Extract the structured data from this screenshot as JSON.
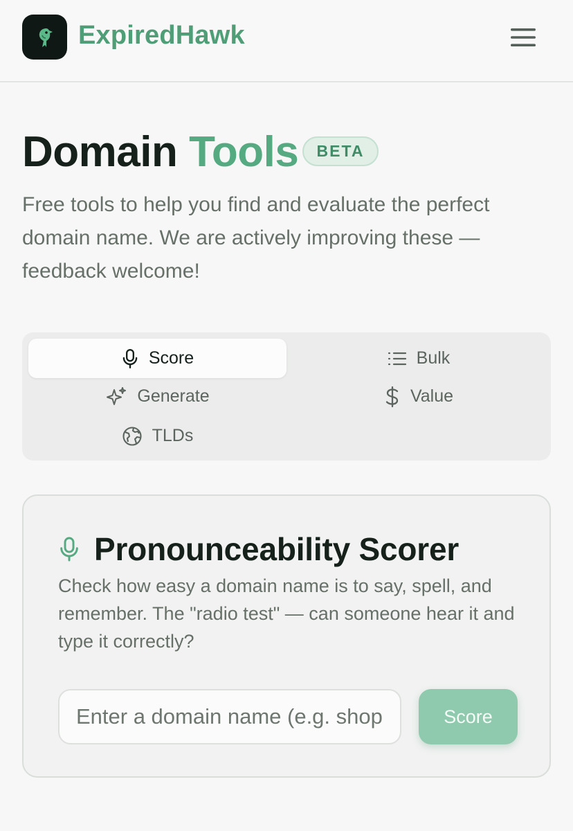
{
  "header": {
    "brand": "ExpiredHawk",
    "logo_icon": "hawk-logo-icon",
    "menu_icon": "hamburger-menu-icon"
  },
  "hero": {
    "title_part1": "Domain",
    "title_part2": "Tools",
    "badge": "BETA",
    "subtitle": "Free tools to help you find and evaluate the perfect domain name. We are actively improving these — feedback welcome!"
  },
  "tabs": [
    {
      "label": "Score",
      "icon": "microphone-icon",
      "active": true
    },
    {
      "label": "Bulk",
      "icon": "list-icon",
      "active": false
    },
    {
      "label": "Generate",
      "icon": "sparkles-icon",
      "active": false
    },
    {
      "label": "Value",
      "icon": "dollar-icon",
      "active": false
    },
    {
      "label": "TLDs",
      "icon": "globe-icon",
      "active": false
    }
  ],
  "card": {
    "icon": "microphone-icon",
    "title": "Pronounceability Scorer",
    "description": "Check how easy a domain name is to say, spell, and remember. The \"radio test\" — can someone hear it and type it correctly?",
    "input_placeholder": "Enter a domain name (e.g. shopify.com)",
    "input_value": "",
    "button_label": "Score"
  },
  "colors": {
    "accent": "#55aa82",
    "brand": "#4f9e77",
    "button_bg": "#8fcaae",
    "badge_bg": "#e1efe7"
  }
}
